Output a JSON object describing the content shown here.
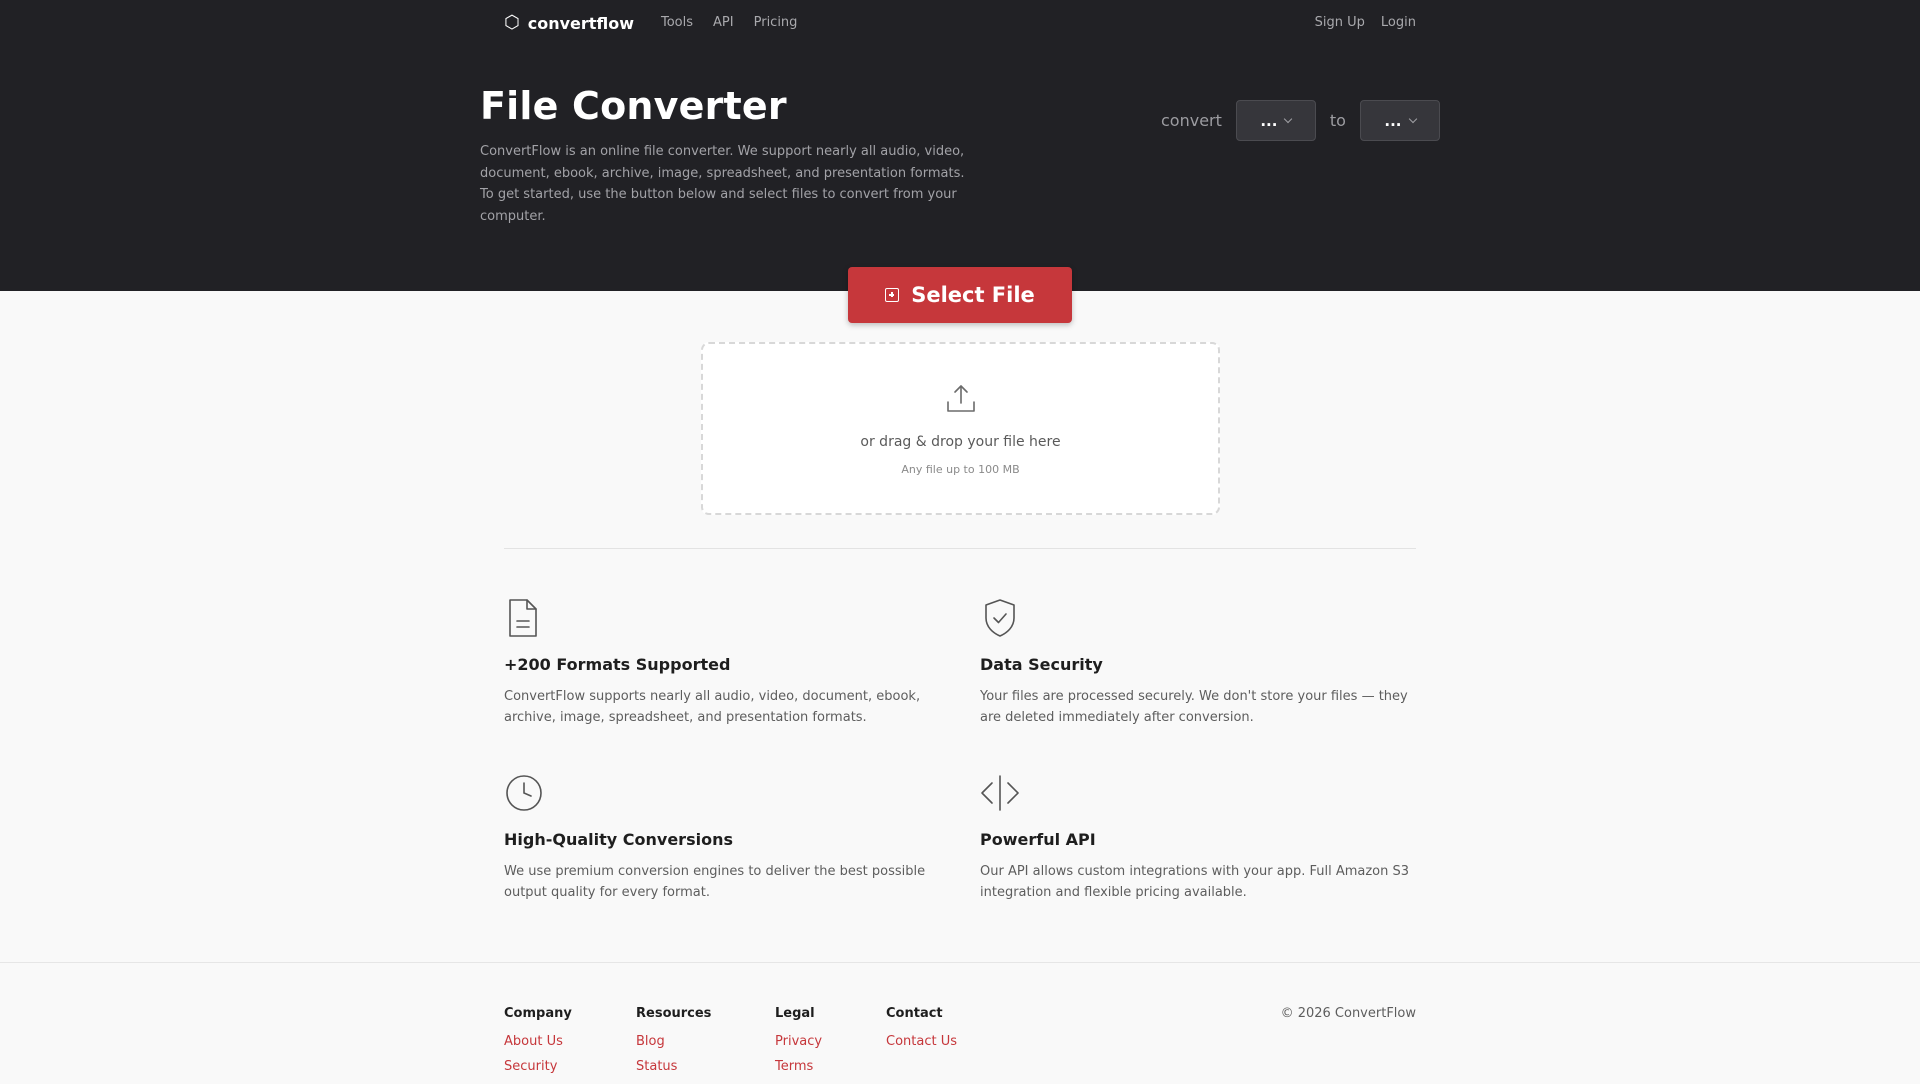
{
  "nav": {
    "logo_icon": "⬡",
    "logo_text": "convertflow",
    "links": [
      "Tools",
      "API",
      "Pricing"
    ],
    "signup": "Sign Up",
    "login": "Login"
  },
  "hero": {
    "title": "File Converter",
    "description": "ConvertFlow is an online file converter. We support nearly all audio, video, document, ebook, archive, image, spreadsheet, and presentation formats. To get started, use the button below and select files to convert from your computer.",
    "convert_label": "convert",
    "to_label": "to",
    "from_value": "...",
    "to_value": "..."
  },
  "select_button": {
    "label": "Select File"
  },
  "dropzone": {
    "main_text": "or drag & drop your file here",
    "sub_text": "Any file up to 100 MB"
  },
  "features": [
    {
      "icon": "document-icon",
      "title": "+200 Formats Supported",
      "text": "ConvertFlow supports nearly all audio, video, document, ebook, archive, image, spreadsheet, and presentation formats."
    },
    {
      "icon": "shield-check-icon",
      "title": "Data Security",
      "text": "Your files are processed securely. We don't store your files — they are deleted immediately after conversion."
    },
    {
      "icon": "clock-icon",
      "title": "High-Quality Conversions",
      "text": "We use premium conversion engines to deliver the best possible output quality for every format."
    },
    {
      "icon": "code-icon",
      "title": "Powerful API",
      "text": "Our API allows custom integrations with your app. Full Amazon S3 integration and flexible pricing available."
    }
  ],
  "footer": {
    "columns": [
      {
        "heading": "Company",
        "links": [
          "About Us",
          "Security"
        ]
      },
      {
        "heading": "Resources",
        "links": [
          "Blog",
          "Status"
        ]
      },
      {
        "heading": "Legal",
        "links": [
          "Privacy",
          "Terms"
        ]
      },
      {
        "heading": "Contact",
        "links": [
          "Contact Us"
        ]
      }
    ],
    "copyright": "© 2026 ConvertFlow"
  },
  "colors": {
    "hero_bg": "#212125",
    "accent": "#c6373b",
    "page_bg": "#f9f9f9"
  }
}
